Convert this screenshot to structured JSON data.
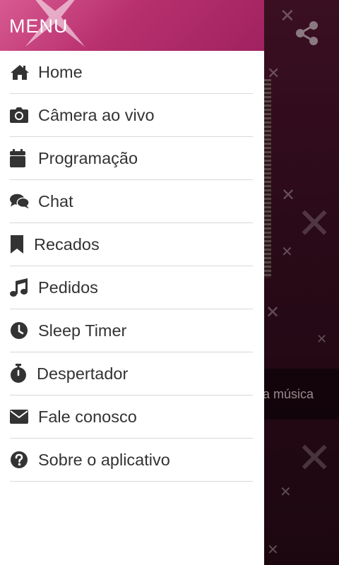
{
  "drawer": {
    "title": "MENU",
    "items": [
      {
        "label": "Home",
        "icon": "home-icon"
      },
      {
        "label": "Câmera ao vivo",
        "icon": "camera-icon"
      },
      {
        "label": "Programação",
        "icon": "calendar-icon"
      },
      {
        "label": "Chat",
        "icon": "chat-icon"
      },
      {
        "label": "Recados",
        "icon": "bookmark-icon"
      },
      {
        "label": "Pedidos",
        "icon": "music-note-icon"
      },
      {
        "label": "Sleep Timer",
        "icon": "clock-icon"
      },
      {
        "label": "Despertador",
        "icon": "stopwatch-icon"
      },
      {
        "label": "Fale conosco",
        "icon": "envelope-icon"
      },
      {
        "label": "Sobre o aplicativo",
        "icon": "question-circle-icon"
      }
    ]
  },
  "background": {
    "now_playing_text": "a música",
    "share_icon": "share-icon"
  },
  "colors": {
    "header_pink": "#b8306e",
    "icon_dark": "#333333",
    "divider": "#d8d8d8",
    "background_dark": "#2a0a18"
  }
}
